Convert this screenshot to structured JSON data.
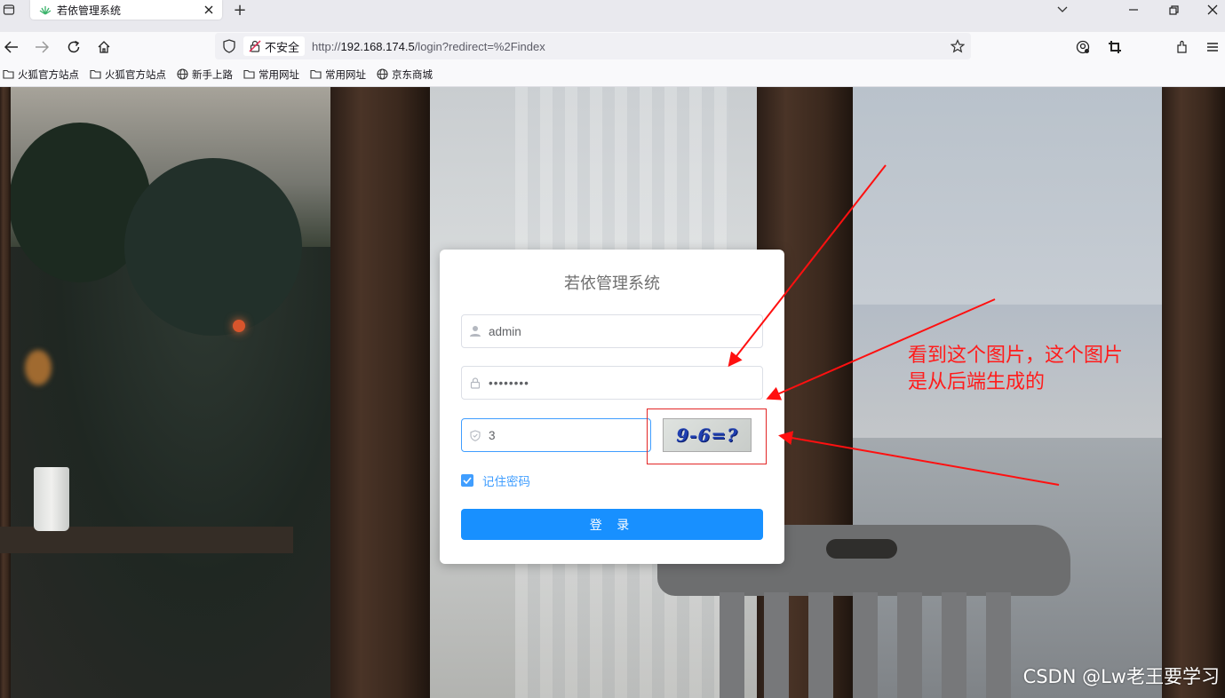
{
  "browser": {
    "tab_title": "若依管理系统",
    "new_tab_symbol": "+",
    "security_label": "不安全",
    "url_prefix": "http://",
    "url_host": "192.168.174.5",
    "url_path": "/login?redirect=%2Findex"
  },
  "bookmarks": [
    {
      "label": "火狐官方站点",
      "icon": "folder-icon"
    },
    {
      "label": "火狐官方站点",
      "icon": "folder-icon"
    },
    {
      "label": "新手上路",
      "icon": "globe-icon"
    },
    {
      "label": "常用网址",
      "icon": "folder-icon"
    },
    {
      "label": "常用网址",
      "icon": "folder-icon"
    },
    {
      "label": "京东商城",
      "icon": "globe-icon"
    }
  ],
  "login": {
    "title": "若依管理系统",
    "username_value": "admin",
    "password_value": "••••••••",
    "captcha_input_value": "3",
    "captcha_image_text": "9-6=?",
    "remember_label": "记住密码",
    "remember_checked": true,
    "submit_label": "登 录"
  },
  "annotation": {
    "line1": "看到这个图片，这个图片",
    "line2": "是从后端生成的"
  },
  "watermark": "CSDN @Lw老王要学习",
  "colors": {
    "primary": "#1890ff",
    "link_blue": "#409eff",
    "annotation_red": "#ff1c1c"
  }
}
